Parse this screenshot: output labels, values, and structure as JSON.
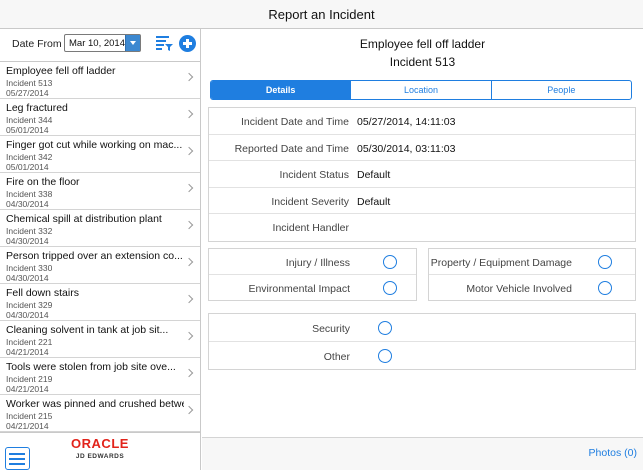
{
  "header": {
    "title": "Report an Incident"
  },
  "filter": {
    "date_label": "Date From",
    "date_value": "Mar 10, 2014"
  },
  "incidents": [
    {
      "title": "Employee fell off ladder",
      "number": "Incident 513",
      "date": "05/27/2014"
    },
    {
      "title": "Leg fractured",
      "number": "Incident 344",
      "date": "05/01/2014"
    },
    {
      "title": "Finger got cut while working on mac...",
      "number": "Incident 342",
      "date": "05/01/2014"
    },
    {
      "title": "Fire on the floor",
      "number": "Incident 338",
      "date": "04/30/2014"
    },
    {
      "title": "Chemical spill at distribution plant",
      "number": "Incident 332",
      "date": "04/30/2014"
    },
    {
      "title": "Person tripped over an extension co...",
      "number": "Incident 330",
      "date": "04/30/2014"
    },
    {
      "title": "Fell down stairs",
      "number": "Incident 329",
      "date": "04/30/2014"
    },
    {
      "title": "Cleaning solvent in tank at job sit...",
      "number": "Incident 221",
      "date": "04/21/2014"
    },
    {
      "title": "Tools were stolen from job site ove...",
      "number": "Incident 219",
      "date": "04/21/2014"
    },
    {
      "title": "Worker was pinned and crushed betwe",
      "number": "Incident 215",
      "date": "04/21/2014"
    }
  ],
  "branding": {
    "logo_main": "ORACLE",
    "logo_sub": "JD EDWARDS"
  },
  "detail": {
    "title": "Employee fell off ladder",
    "incident": "Incident 513",
    "tabs": [
      "Details",
      "Location",
      "People"
    ],
    "fields": [
      {
        "label": "Incident Date and Time",
        "value": "05/27/2014, 14:11:03"
      },
      {
        "label": "Reported Date and Time",
        "value": "05/30/2014, 03:11:03"
      },
      {
        "label": "Incident Status",
        "value": "Default"
      },
      {
        "label": "Incident Severity",
        "value": "Default"
      },
      {
        "label": "Incident Handler",
        "value": ""
      }
    ],
    "categories_left": [
      "Injury / Illness",
      "Environmental Impact"
    ],
    "categories_right": [
      "Property / Equipment Damage",
      "Motor Vehicle Involved"
    ],
    "categories_bottom": [
      "Security",
      "Other"
    ]
  },
  "footer": {
    "photos": "Photos (0)"
  },
  "colors": {
    "accent": "#1f7ee0",
    "oracle_red": "#e2231a"
  }
}
